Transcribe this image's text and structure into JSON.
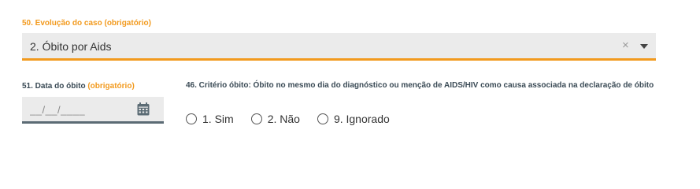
{
  "evolucao": {
    "label": "50. Evolução do caso (obrigatório)",
    "value": "2. Óbito por Aids",
    "clear_glyph": "×",
    "icons": [
      "close-icon",
      "chevron-down-icon"
    ],
    "accent_color": "#f29a1e"
  },
  "data_obito": {
    "label": "51. Data do óbito",
    "required": "(obrigatório)",
    "placeholder": "__/__/____",
    "icon": "calendar-icon"
  },
  "criterio": {
    "label": "46. Critério óbito: Óbito no mesmo dia do diagnóstico ou menção de AIDS/HIV como causa associada na declaração de óbito",
    "options": [
      {
        "label": "1. Sim"
      },
      {
        "label": "2. Não"
      },
      {
        "label": "9. Ignorado"
      }
    ]
  }
}
